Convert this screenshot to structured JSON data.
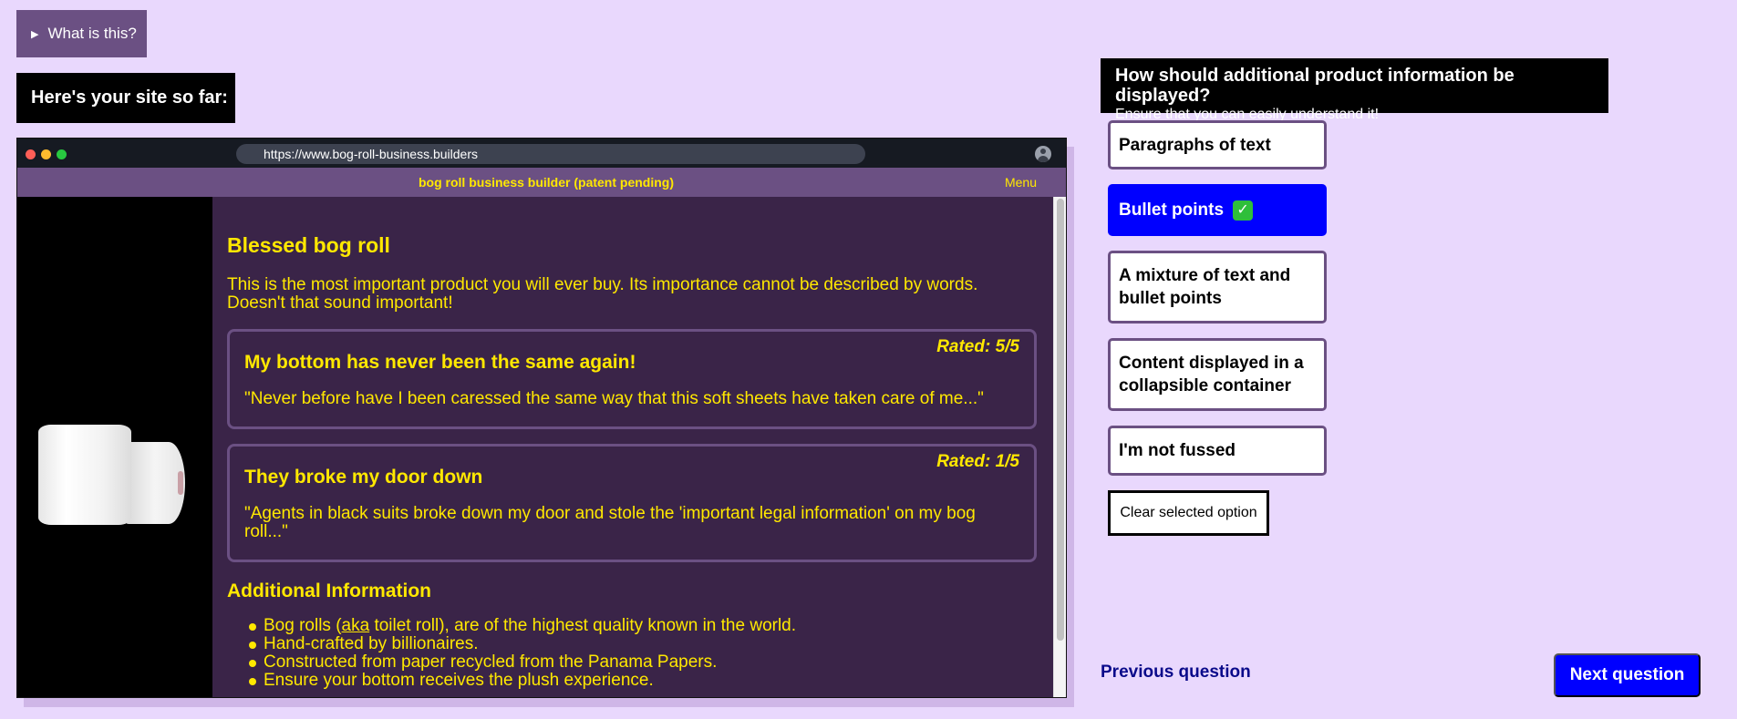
{
  "help": {
    "label": "What is this?"
  },
  "site_label": "Here's your site so far:",
  "browser": {
    "url": "https://www.bog-roll-business.builders",
    "site_title": "bog roll business builder (patent pending)",
    "menu_label": "Menu"
  },
  "product": {
    "title": "Blessed bog roll",
    "description": "This is the most important product you will ever buy. Its importance cannot be described by words. Doesn't that sound important!",
    "reviews": [
      {
        "rating": "Rated: 5/5",
        "title": "My bottom has never been the same again!",
        "text": "\"Never before have I been caressed the same way that this soft sheets have taken care of me...\""
      },
      {
        "rating": "Rated: 1/5",
        "title": "They broke my door down",
        "text": "\"Agents in black suits broke down my door and stole the 'important legal information' on my bog roll...\""
      }
    ],
    "additional_title": "Additional Information",
    "additional_items": {
      "item0_pre": "Bog rolls (",
      "item0_link": "aka",
      "item0_post": " toilet roll), are of the highest quality known in the world.",
      "item1": "Hand-crafted by billionaires.",
      "item2": "Constructed from paper recycled from the Panama Papers.",
      "item3": "Ensure your bottom receives the plush experience."
    }
  },
  "question": {
    "title": "How should additional product information be displayed?",
    "subtitle": "Ensure that you can easily understand it!"
  },
  "options": [
    {
      "label": "Paragraphs of text",
      "selected": false
    },
    {
      "label": "Bullet points",
      "selected": true
    },
    {
      "label": "A mixture of text and bullet points",
      "selected": false
    },
    {
      "label": "Content displayed in a collapsible container",
      "selected": false
    },
    {
      "label": "I'm not fussed",
      "selected": false
    }
  ],
  "check_icon": "✓",
  "clear_label": "Clear selected option",
  "prev_label": "Previous question",
  "next_label": "Next question",
  "colors": {
    "page_bg": "#e9d8fd",
    "accent_purple": "#6b5083",
    "site_bg": "#3a2448",
    "site_text": "#ffe800",
    "selected_blue": "#0000ff"
  }
}
